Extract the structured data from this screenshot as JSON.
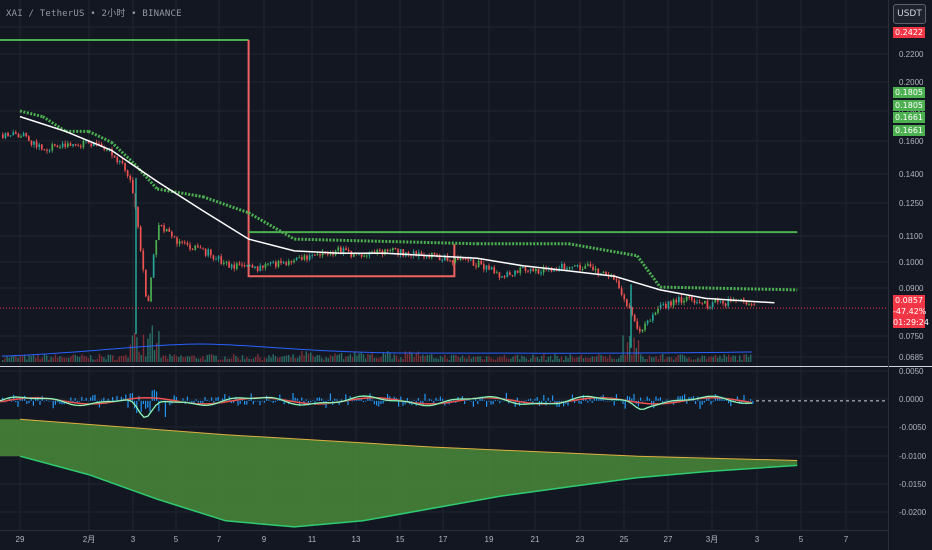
{
  "title": "XAI / TetherUS • 2小时 • BINANCE",
  "currency_button": "USDT",
  "colors": {
    "background": "#131722",
    "candle_up": "#26a69a",
    "candle_up_alt": "#4caf50",
    "candle_down": "#ef5350",
    "ma_line": "#ffffff",
    "trail_stop": "#4caf50",
    "box_line": "#f0625f",
    "volume_ma": "#2962ff",
    "macd_hist": "#2196f3",
    "osc_fill": "#4a8a3a",
    "osc_line": "#2ecc71",
    "osc_signal": "#e0b040",
    "current_price_line": "#f23645"
  },
  "price_badges": {
    "top": "0.2422",
    "green": [
      "0.1805",
      "0.1805",
      "0.1661",
      "0.1661"
    ],
    "current": "0.0857",
    "change": "-47.42%",
    "countdown": "01:29:24"
  },
  "chart_data": {
    "type": "candlestick",
    "title": "XAI / TetherUS • 2小时 • BINANCE",
    "price_axis": {
      "scale": "log",
      "range": [
        0.0685,
        0.27
      ],
      "ticks": [
        "0.2200",
        "0.2000",
        "0.1800",
        "0.1600",
        "0.1400",
        "0.1250",
        "0.1100",
        "0.1000",
        "0.0900",
        "0.0750",
        "0.0685"
      ]
    },
    "x_axis": {
      "tick_labels": [
        "29",
        "2月",
        "3",
        "5",
        "7",
        "9",
        "11",
        "13",
        "15",
        "17",
        "19",
        "21",
        "23",
        "25",
        "27",
        "3月",
        "3",
        "5",
        "7"
      ]
    },
    "series": [
      {
        "name": "close",
        "x": [
          "01-29",
          "01-30",
          "01-31",
          "02-01",
          "02-02",
          "02-03",
          "02-03",
          "02-04",
          "02-05",
          "02-06",
          "02-07",
          "02-08",
          "02-09",
          "02-10",
          "02-11",
          "02-12",
          "02-13",
          "02-14",
          "02-15",
          "02-16",
          "02-17",
          "02-18",
          "02-19",
          "02-20",
          "02-21",
          "02-22",
          "02-23",
          "02-24",
          "02-25",
          "02-26",
          "02-27",
          "02-28",
          "03-01",
          "03-02",
          "03-03"
        ],
        "values": [
          0.168,
          0.159,
          0.161,
          0.163,
          0.157,
          0.142,
          0.084,
          0.118,
          0.11,
          0.107,
          0.102,
          0.1,
          0.101,
          0.104,
          0.106,
          0.107,
          0.105,
          0.107,
          0.106,
          0.105,
          0.103,
          0.102,
          0.097,
          0.1,
          0.099,
          0.101,
          0.1,
          0.096,
          0.078,
          0.086,
          0.089,
          0.087,
          0.088,
          0.086,
          0.0857
        ]
      },
      {
        "name": "moving_average",
        "x": [
          "01-29",
          "01-31",
          "02-02",
          "02-04",
          "02-06",
          "02-08",
          "02-10",
          "02-12",
          "02-14",
          "02-16",
          "02-18",
          "02-20",
          "02-22",
          "02-24",
          "02-26",
          "02-28",
          "03-02"
        ],
        "values": [
          0.18,
          0.17,
          0.158,
          0.14,
          0.125,
          0.112,
          0.107,
          0.106,
          0.106,
          0.105,
          0.104,
          0.101,
          0.099,
          0.097,
          0.092,
          0.089,
          0.0875
        ]
      },
      {
        "name": "trailing_stop",
        "x": [
          "01-29",
          "01-30",
          "01-31",
          "02-01",
          "02-02",
          "02-03",
          "02-04",
          "02-06",
          "02-08",
          "02-10",
          "02-18",
          "02-22",
          "02-25",
          "02-26",
          "03-03"
        ],
        "values": [
          0.184,
          0.18,
          0.17,
          0.17,
          0.163,
          0.15,
          0.136,
          0.132,
          0.124,
          0.112,
          0.11,
          0.11,
          0.105,
          0.093,
          0.092
        ]
      }
    ],
    "box": {
      "outer_level": 0.2422,
      "drop_date": "02-08",
      "lower_level": 0.097,
      "lower_end": "02-17",
      "upper_level": 0.109,
      "upper_end": "03-03"
    },
    "oscillator": {
      "range": [
        -0.021,
        0.0055
      ],
      "ticks": [
        "0.0050",
        "0.0000",
        "-0.0050",
        "-0.0100",
        "-0.0150",
        "-0.0200"
      ],
      "area_lower": {
        "x": [
          "01-29",
          "02-01",
          "02-04",
          "02-07",
          "02-10",
          "02-13",
          "02-16",
          "02-19",
          "02-22",
          "02-25",
          "02-28",
          "03-03"
        ],
        "values": [
          -0.009,
          -0.012,
          -0.016,
          -0.0195,
          -0.0205,
          -0.0195,
          -0.0175,
          -0.0155,
          -0.014,
          -0.0125,
          -0.0115,
          -0.0105
        ]
      },
      "signal_line": {
        "x": [
          "01-29",
          "02-07",
          "02-16",
          "02-25",
          "03-03"
        ],
        "values": [
          -0.003,
          -0.0055,
          -0.0075,
          -0.009,
          -0.0097
        ]
      }
    }
  }
}
